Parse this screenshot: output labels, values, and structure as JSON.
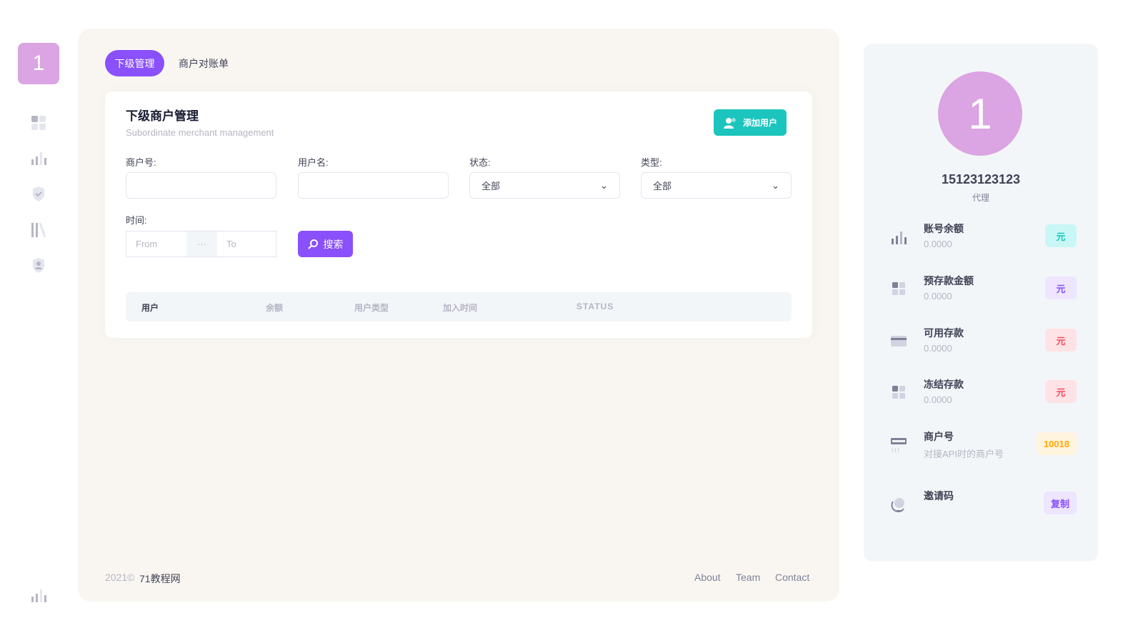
{
  "logo": {
    "text": "1"
  },
  "tabs": [
    {
      "label": "下级管理"
    },
    {
      "label": "商户对账单"
    }
  ],
  "card": {
    "title": "下级商户管理",
    "subtitle": "Subordinate merchant management",
    "add_button": "添加用户"
  },
  "filters": {
    "merchant_no": {
      "label": "商户号:",
      "value": ""
    },
    "username": {
      "label": "用户名:",
      "value": ""
    },
    "status": {
      "label": "状态:",
      "value": "全部"
    },
    "type": {
      "label": "类型:",
      "value": "全部"
    },
    "time": {
      "label": "时间:",
      "from_placeholder": "From",
      "separator": "···",
      "to_placeholder": "To"
    },
    "search_button": "搜索"
  },
  "table": {
    "headers": [
      "用户",
      "余额",
      "用户类型",
      "加入时间",
      "STATUS"
    ]
  },
  "footer": {
    "copyright": "2021©",
    "site": "71教程网",
    "links": [
      "About",
      "Team",
      "Contact"
    ]
  },
  "profile": {
    "avatar": "1",
    "phone": "15123123123",
    "role": "代理",
    "items": [
      {
        "title": "账号余额",
        "value": "0.0000",
        "badge": "元",
        "badge_color": "#1bc5bd",
        "badge_bg": "#c9f7f5"
      },
      {
        "title": "预存款金额",
        "value": "0.0000",
        "badge": "元",
        "badge_color": "#8950fc",
        "badge_bg": "#eee5ff"
      },
      {
        "title": "可用存款",
        "value": "0.0000",
        "badge": "元",
        "badge_color": "#f64e60",
        "badge_bg": "#ffe2e5"
      },
      {
        "title": "冻结存款",
        "value": "0.0000",
        "badge": "元",
        "badge_color": "#f64e60",
        "badge_bg": "#ffe2e5"
      },
      {
        "title": "商户号",
        "value": "对接API时的商户号",
        "badge": "10018",
        "badge_color": "#ffa800",
        "badge_bg": "#fff4de"
      },
      {
        "title": "邀请码",
        "value": "",
        "badge": "复制",
        "badge_color": "#8950fc",
        "badge_bg": "#eee5ff"
      }
    ]
  }
}
